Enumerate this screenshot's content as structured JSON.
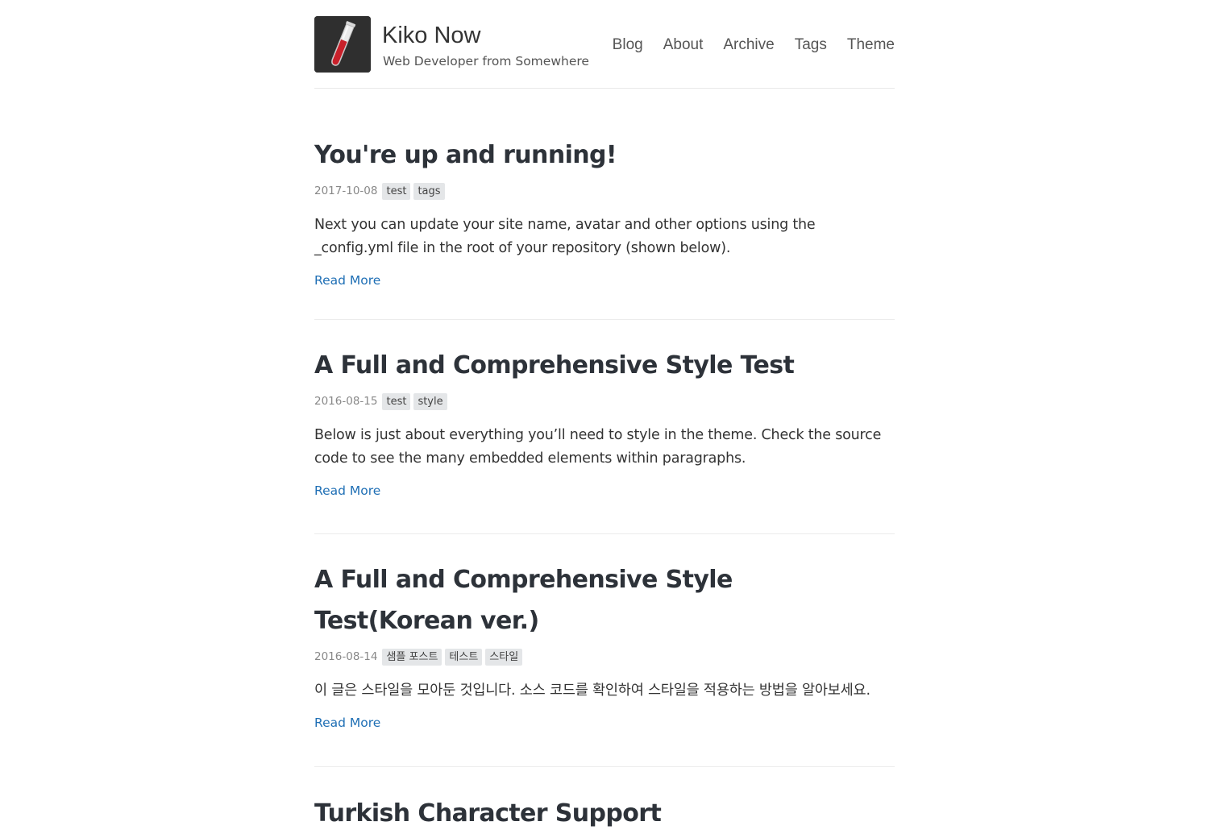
{
  "site": {
    "title": "Kiko Now",
    "description": "Web Developer from Somewhere",
    "avatar_icon": "test-tube-icon"
  },
  "nav": {
    "items": [
      {
        "label": "Blog"
      },
      {
        "label": "About"
      },
      {
        "label": "Archive"
      },
      {
        "label": "Tags"
      },
      {
        "label": "Theme"
      }
    ]
  },
  "posts": [
    {
      "title": "You're up and running!",
      "date": "2017-10-08",
      "tags": [
        "test",
        "tags"
      ],
      "excerpt": "Next you can update your site name, avatar and other options using the _config.yml file in the root of your repository (shown below).",
      "read_more": "Read More"
    },
    {
      "title": "A Full and Comprehensive Style Test",
      "date": "2016-08-15",
      "tags": [
        "test",
        "style"
      ],
      "excerpt": "Below is just about everything you’ll need to style in the theme. Check the source code to see the many embedded elements within paragraphs.",
      "read_more": "Read More"
    },
    {
      "title": "A Full and Comprehensive Style Test(Korean ver.)",
      "date": "2016-08-14",
      "tags": [
        "샘플 포스트",
        "테스트",
        "스타일"
      ],
      "excerpt": "이 글은 스타일을 모아둔 것입니다. 소스 코드를 확인하여 스타일을 적용하는 방법을 알아보세요.",
      "read_more": "Read More"
    },
    {
      "title": "Turkish Character Support"
    }
  ],
  "colors": {
    "title_text": "#2d3239",
    "link": "#1f6fb5",
    "tag_bg": "#e4e6e8",
    "avatar_bg": "#2f2f2f",
    "tube_liquid": "#c8202a"
  }
}
